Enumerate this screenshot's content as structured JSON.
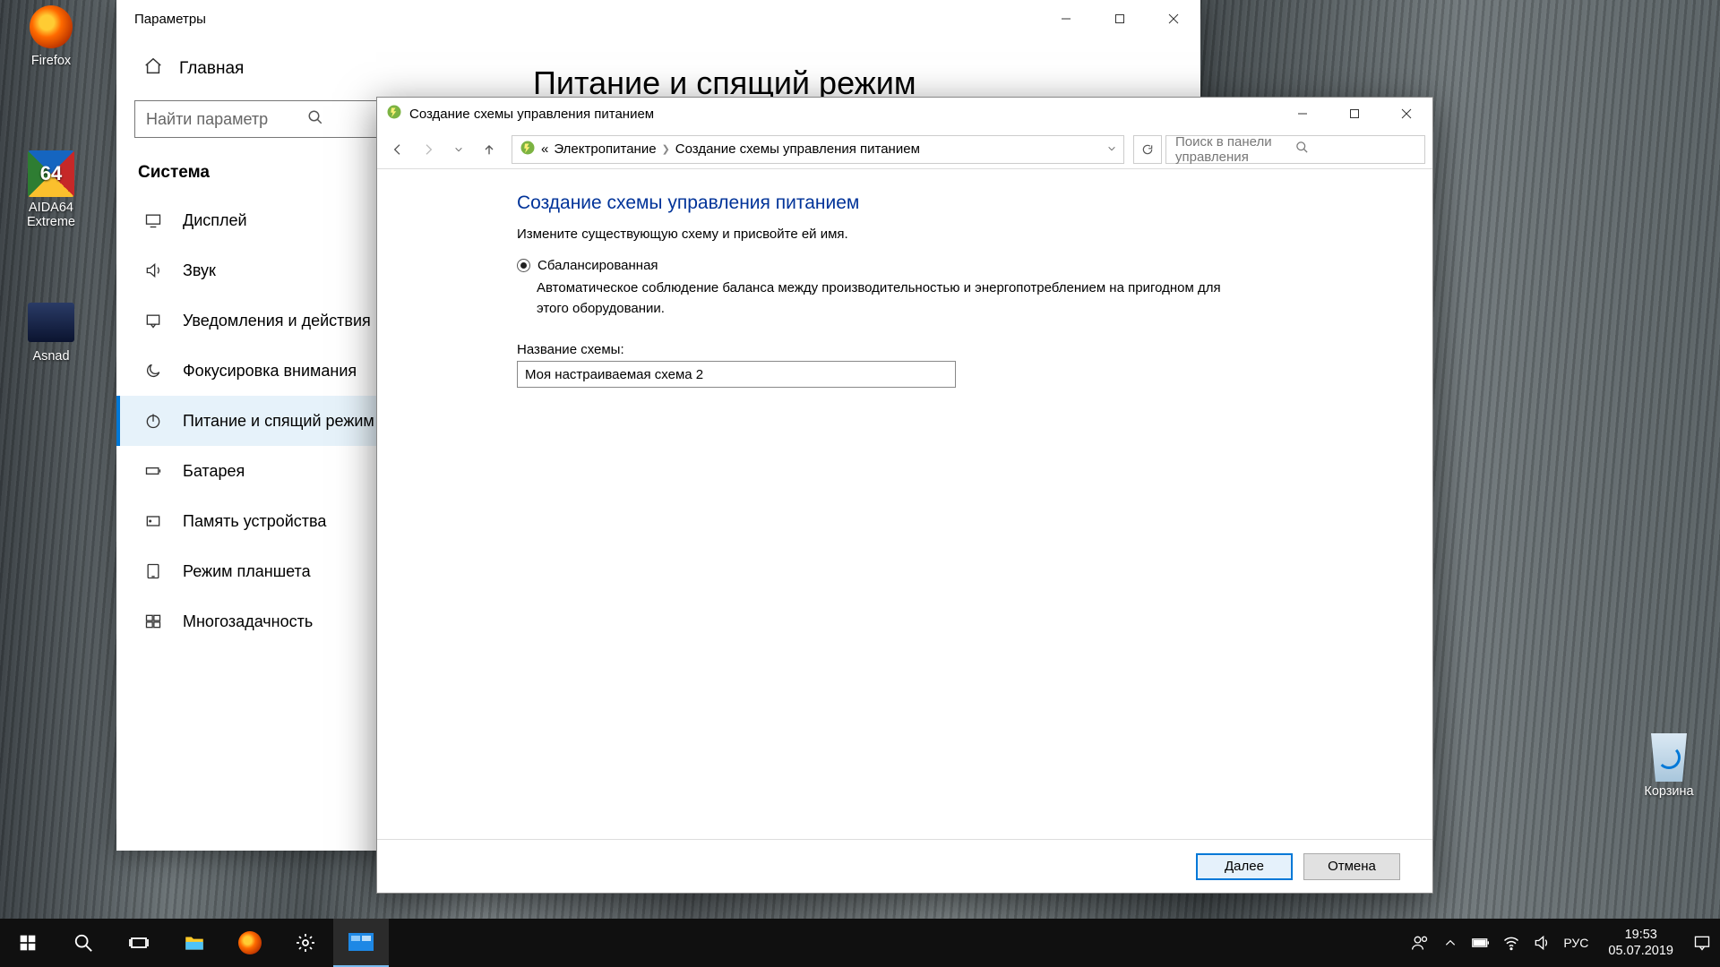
{
  "desktop_icons": {
    "firefox": "Firefox",
    "aida": "AIDA64 Extreme",
    "asnad": "Asnad",
    "recycle": "Корзина"
  },
  "settings": {
    "title": "Параметры",
    "home": "Главная",
    "search_placeholder": "Найти параметр",
    "category": "Система",
    "items": [
      "Дисплей",
      "Звук",
      "Уведомления и действия",
      "Фокусировка внимания",
      "Питание и спящий режим",
      "Батарея",
      "Память устройства",
      "Режим планшета",
      "Многозадачность"
    ],
    "page_heading": "Питание и спящий режим"
  },
  "cp": {
    "title": "Создание схемы управления питанием",
    "crumb_root_prefix": "«",
    "crumb1": "Электропитание",
    "crumb2": "Создание схемы управления питанием",
    "search_placeholder": "Поиск в панели управления",
    "heading": "Создание схемы управления питанием",
    "subtitle": "Измените существующую схему и присвойте ей имя.",
    "plan_name": "Сбалансированная",
    "plan_desc": "Автоматическое соблюдение баланса между производительностью и энергопотреблением на пригодном для этого оборудовании.",
    "field_label": "Название схемы:",
    "field_value": "Моя настраиваемая схема 2",
    "next": "Далее",
    "cancel": "Отмена"
  },
  "taskbar": {
    "lang": "РУС",
    "time": "19:53",
    "date": "05.07.2019"
  }
}
